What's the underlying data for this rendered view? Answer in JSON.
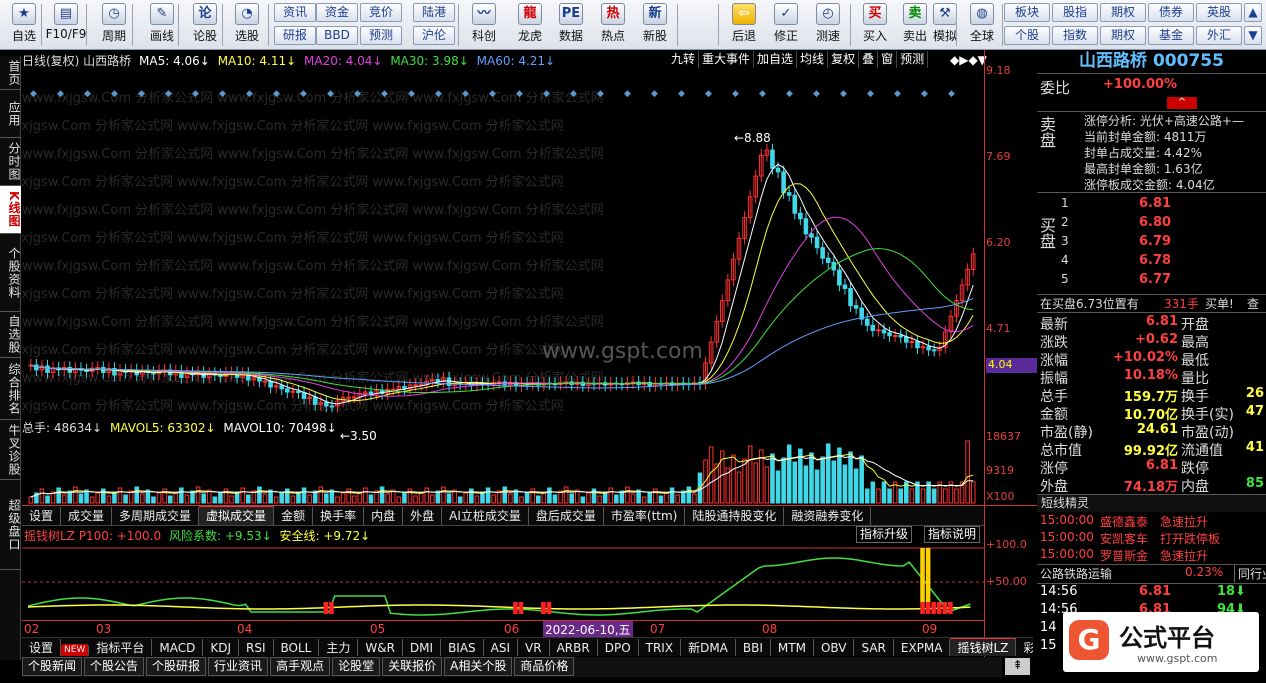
{
  "toolbar": {
    "buttons": [
      {
        "label": "自选",
        "icon": "star-icon"
      },
      {
        "label": "F10/F9",
        "icon": "f10-icon"
      },
      {
        "label": "周期",
        "icon": "clock-icon"
      },
      {
        "label": "画线",
        "icon": "pen-icon"
      },
      {
        "label": "论股",
        "icon": "lungu-icon"
      },
      {
        "label": "选股",
        "icon": "select-stock-icon"
      },
      {
        "label": "科创",
        "icon": "chart-icon"
      },
      {
        "label": "龙虎",
        "icon": "dragon-tiger-icon"
      },
      {
        "label": "数据",
        "icon": "pe-icon"
      },
      {
        "label": "热点",
        "icon": "hot-icon"
      },
      {
        "label": "新股",
        "icon": "ipo-icon"
      },
      {
        "label": "后退",
        "icon": "back-arrow-icon"
      },
      {
        "label": "修正",
        "icon": "correct-icon"
      },
      {
        "label": "测速",
        "icon": "speed-icon"
      },
      {
        "label": "买入",
        "icon": "buy-icon"
      },
      {
        "label": "卖出",
        "icon": "sell-icon"
      },
      {
        "label": "模拟",
        "icon": "hammer-icon"
      },
      {
        "label": "全球",
        "icon": "globe-icon"
      }
    ],
    "small_buttons_left": [
      "资讯",
      "研报",
      "资金",
      "BBD",
      "竞价",
      "预测",
      "陆港",
      "沪伦"
    ],
    "small_buttons_right": [
      "板块",
      "个股",
      "股指",
      "指数",
      "期权",
      "期权",
      "债券",
      "基金",
      "英股",
      "外汇"
    ],
    "small_icons": [
      "▲",
      "▼"
    ]
  },
  "left_nav": [
    "首页",
    "应用",
    "分时图",
    "K线图",
    "个股资料",
    "自选股",
    "综合排名",
    "牛叉诊股",
    "超级盘口"
  ],
  "chart_header": {
    "label": "日线(复权) 山西路桥",
    "ma5": "MA5: 4.06",
    "ma10": "MA10: 4.11",
    "ma20": "MA20: 4.04",
    "ma30": "MA30: 3.98",
    "ma60": "MA60: 4.21",
    "buttons": [
      "九转",
      "重大事件",
      "加自选",
      "均线",
      "复权",
      "叠",
      "窗",
      "预测"
    ]
  },
  "price_axis": [
    "9.18",
    "7.69",
    "6.20",
    "4.71"
  ],
  "current_price_tag": "4.04",
  "watermark": "www.fxjgsw.Com 分析家公式网",
  "center_watermark": "www.gspt.com",
  "annotations": {
    "high": "8.88",
    "low": "3.50",
    "L": "L",
    "bang": "榜"
  },
  "volume_header": {
    "vol": "总手: 48634",
    "mavol5": "MAVOL5: 63302",
    "mavol10": "MAVOL10: 70498"
  },
  "volume_axis": [
    "18637",
    "9319",
    "X100"
  ],
  "volume_tabs": [
    "设置",
    "成交量",
    "多周期成交量",
    "虚拟成交量",
    "金额",
    "换手率",
    "内盘",
    "外盘",
    "AI立桩成交量",
    "盘后成交量",
    "市盈率(ttm)",
    "陆股通持股变化",
    "融资融券变化"
  ],
  "indicator_header": {
    "name": "摇钱树LZ P100: +100.0",
    "risk": "风险系数: +9.53",
    "safe": "安全线: +9.72",
    "btn_upgrade": "指标升级",
    "btn_desc": "指标说明"
  },
  "indicator_axis": [
    "+100.0",
    "+50.00"
  ],
  "x_axis": [
    "02",
    "03",
    "04",
    "05",
    "06",
    "07",
    "08",
    "09"
  ],
  "date_tag": "2022-06-10,五",
  "bottom_tabs": [
    "设置",
    "NEW",
    "指标平台",
    "MACD",
    "KDJ",
    "RSI",
    "BOLL",
    "主力",
    "W&R",
    "DMI",
    "BIAS",
    "ASI",
    "VR",
    "ARBR",
    "DPO",
    "TRIX",
    "新DMA",
    "BBI",
    "MTM",
    "OBV",
    "SAR",
    "EXPMA",
    "摇钱树LZ",
    "彩..."
  ],
  "bottom_links": [
    "个股新闻",
    "个股公告",
    "个股研报",
    "行业资讯",
    "高手观点",
    "论股堂",
    "关联报价",
    "A相关个股",
    "商品价格"
  ],
  "right_panel": {
    "stock_name": "山西路桥",
    "stock_code": "000755",
    "weibi_label": "委比",
    "weibi": "+100.00%",
    "sell_label": "卖盘",
    "buy_label": "买盘",
    "limit_analysis": "涨停分析: 光伏+高速公路+—",
    "limit_rows": [
      "当前封单金额: 4811万",
      "封单占成交量: 4.42%",
      "最高封单金额: 1.63亿",
      "涨停板成交金额: 4.04亿"
    ],
    "bids": [
      {
        "n": "1",
        "p": "6.81"
      },
      {
        "n": "2",
        "p": "6.80"
      },
      {
        "n": "3",
        "p": "6.79"
      },
      {
        "n": "4",
        "p": "6.78"
      },
      {
        "n": "5",
        "p": "6.77"
      }
    ],
    "queue": {
      "text": "在买盘6.73位置有",
      "vol": "331手",
      "act": "买单!",
      "btn": "查"
    },
    "stats": [
      {
        "l": "最新",
        "v": "6.81",
        "l2": "开盘",
        "v2": ""
      },
      {
        "l": "涨跌",
        "v": "+0.62",
        "l2": "最高",
        "v2": ""
      },
      {
        "l": "涨幅",
        "v": "+10.02%",
        "l2": "最低",
        "v2": ""
      },
      {
        "l": "振幅",
        "v": "10.18%",
        "l2": "量比",
        "v2": ""
      },
      {
        "l": "总手",
        "v": "159.7万",
        "l2": "换手",
        "v2": "26"
      },
      {
        "l": "金额",
        "v": "10.70亿",
        "l2": "换手(实)",
        "v2": "47"
      },
      {
        "l": "市盈(静)",
        "v": "24.61",
        "l2": "市盈(动)",
        "v2": ""
      },
      {
        "l": "总市值",
        "v": "99.92亿",
        "l2": "流通值",
        "v2": "41"
      },
      {
        "l": "涨停",
        "v": "6.81",
        "l2": "跌停",
        "v2": ""
      },
      {
        "l": "外盘",
        "v": "74.18万",
        "l2": "内盘",
        "v2": "85"
      }
    ],
    "short_title": "短线精灵",
    "short_rows": [
      {
        "t": "15:00:00",
        "s": "盛德鑫泰",
        "e": "急速拉升"
      },
      {
        "t": "15:00:00",
        "s": "安凯客车",
        "e": "打开跌停板"
      },
      {
        "t": "15:00:00",
        "s": "罗普斯金",
        "e": "急速拉升"
      }
    ],
    "sector": {
      "name": "公路铁路运输",
      "pct": "0.23%",
      "btn": "同行业"
    },
    "ticks": [
      {
        "t": "14:56",
        "p": "6.81",
        "v": "18"
      },
      {
        "t": "14:56",
        "p": "6.81",
        "v": "94"
      },
      {
        "t": "14",
        "p": "",
        "v": ""
      },
      {
        "t": "15",
        "p": "",
        "v": ""
      }
    ]
  },
  "logo": {
    "text": "公式平台",
    "url": "www.gspt.com"
  }
}
